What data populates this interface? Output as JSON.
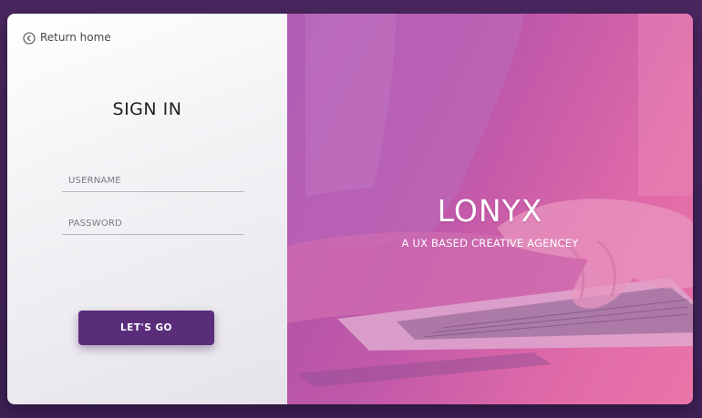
{
  "nav": {
    "return_label": "Return home"
  },
  "login": {
    "title": "SIGN IN",
    "username_placeholder": "USERNAME",
    "password_placeholder": "PASSWORD",
    "submit_label": "LET'S GO"
  },
  "hero": {
    "brand": "LONYX",
    "tagline": "A UX BASED CREATIVE AGENCEY"
  },
  "colors": {
    "button": "#5a2d7a",
    "background": "#4a2760",
    "hero_gradient_start": "#a34ba8",
    "hero_gradient_end": "#f07aa8"
  },
  "icons": {
    "return": "chevron-left-circle-icon"
  }
}
